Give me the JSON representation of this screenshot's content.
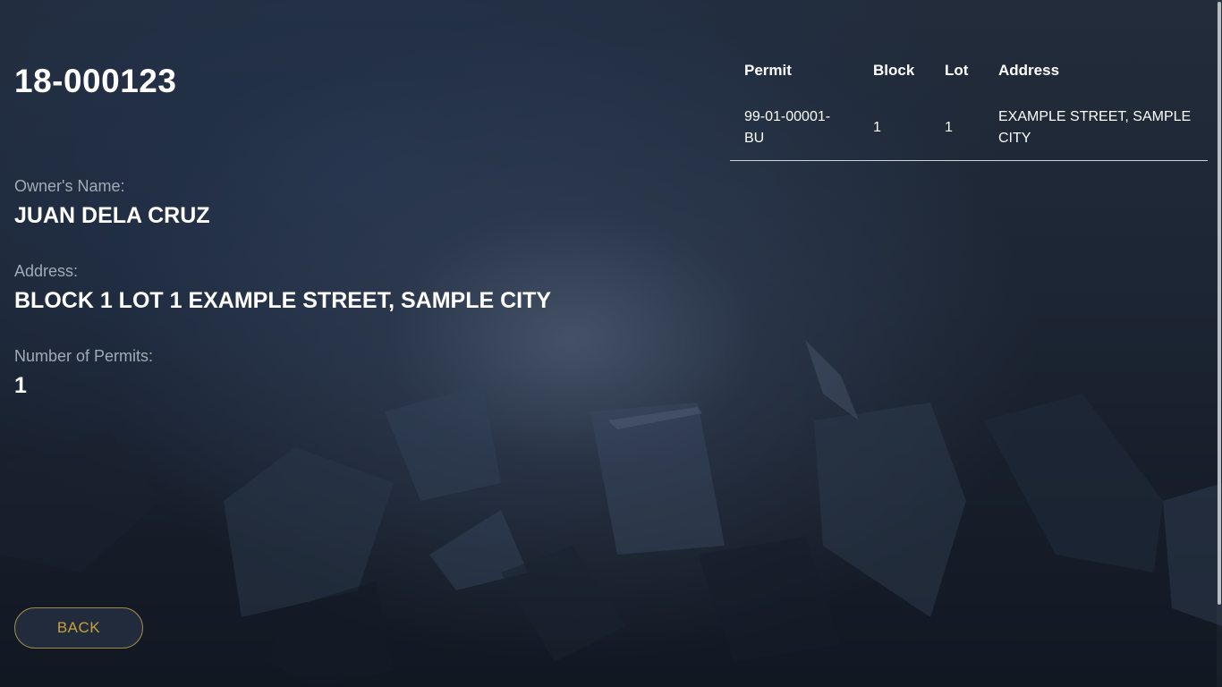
{
  "record": {
    "permit_number": "18-000123",
    "owner_label": "Owner's Name:",
    "owner_name": "JUAN DELA CRUZ",
    "address_label": "Address:",
    "address": "BLOCK 1 LOT 1 EXAMPLE STREET, SAMPLE CITY",
    "permit_count_label": "Number of Permits:",
    "permit_count": "1"
  },
  "permits_table": {
    "headers": {
      "permit": "Permit",
      "block": "Block",
      "lot": "Lot",
      "address": "Address"
    },
    "rows": [
      {
        "permit": "99-01-00001-BU",
        "block": "1",
        "lot": "1",
        "address": "EXAMPLE STREET, SAMPLE CITY"
      }
    ]
  },
  "actions": {
    "back_label": "BACK"
  },
  "colors": {
    "accent_gold": "#c5a13f",
    "button_border": "#9d8a4a",
    "label_gray": "#a3aab6",
    "background_dark": "#1c2533"
  }
}
